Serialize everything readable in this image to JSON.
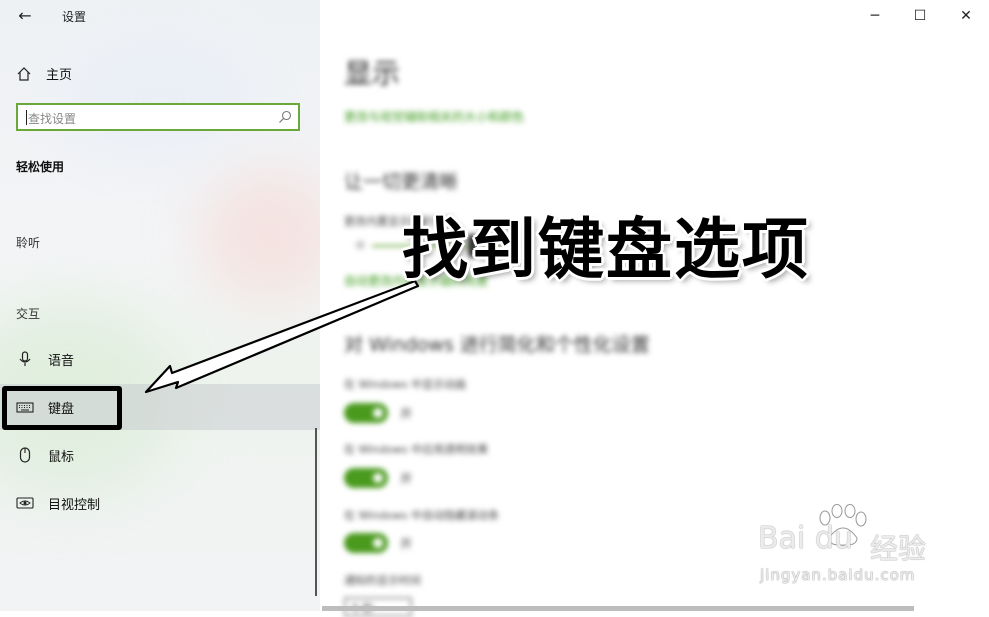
{
  "window": {
    "title": "设置",
    "controls": {
      "minimize": "─",
      "maximize": "☐",
      "close": "✕"
    }
  },
  "sidebar": {
    "back_icon": "arrow-left-icon",
    "home_label": "主页",
    "search_placeholder": "查找设置",
    "category": "轻松使用",
    "groups": {
      "hearing": "聆听",
      "interaction": "交互"
    },
    "items": [
      {
        "label": "语音",
        "icon": "microphone-icon",
        "selected": false
      },
      {
        "label": "键盘",
        "icon": "keyboard-icon",
        "selected": true
      },
      {
        "label": "鼠标",
        "icon": "mouse-icon",
        "selected": false
      },
      {
        "label": "目视控制",
        "icon": "eye-control-icon",
        "selected": false
      }
    ]
  },
  "main": {
    "title": "显示",
    "subtitle_link": "更改与视觉辅助相关的大小和颜色",
    "section1_heading": "让一切更清晰",
    "section1_label": "更改内置显示器的亮度",
    "section1_link": "自动更改内置显示器的亮度",
    "section2_heading": "对 Windows 进行简化和个性化设置",
    "settings": [
      {
        "label": "在 Windows 中显示动画",
        "state": "开",
        "on": true
      },
      {
        "label": "在 Windows 中应用透明效果",
        "state": "开",
        "on": true
      },
      {
        "label": "在 Windows 中自动隐藏滚动条",
        "state": "开",
        "on": true
      }
    ],
    "notification_label": "通知的显示时间",
    "dropdown_value": "5 秒"
  },
  "overlay": {
    "caption": "找到键盘选项"
  },
  "watermark": {
    "logo": "Bai du",
    "brand": "经验",
    "url": "jingyan.baidu.com"
  },
  "colors": {
    "accent": "#4a9a1e",
    "link": "#3d9a1c",
    "sidebar_bg": "#eef1f4",
    "highlight_border": "#000000"
  }
}
